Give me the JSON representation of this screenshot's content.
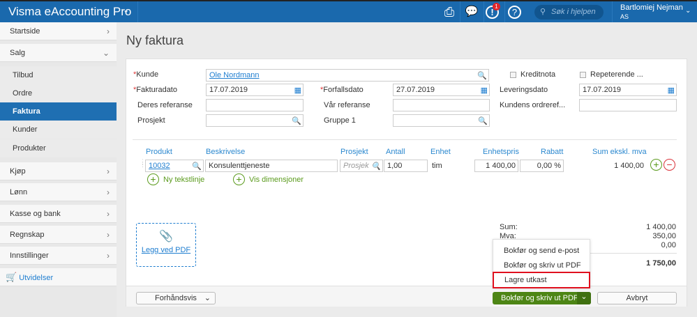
{
  "header": {
    "app_title": "Visma eAccounting Pro",
    "notification_count": "1",
    "search_placeholder": "Søk i hjelpen",
    "user_name": "Bartlomiej Nejman",
    "company": "AS"
  },
  "sidebar": {
    "items": [
      "Startside",
      "Salg",
      "Tilbud",
      "Ordre",
      "Faktura",
      "Kunder",
      "Produkter",
      "Kjøp",
      "Lønn",
      "Kasse og bank",
      "Regnskap",
      "Innstillinger",
      "Utvidelser"
    ]
  },
  "page_title": "Ny faktura",
  "form": {
    "kunde_label": "Kunde",
    "kunde_value": "Ole Nordmann",
    "kreditnota_label": "Kreditnota",
    "repeterende_label": "Repeterende ...",
    "fakturadato_label": "Fakturadato",
    "fakturadato_value": "17.07.2019",
    "forfallsdato_label": "Forfallsdato",
    "forfallsdato_value": "27.07.2019",
    "leveringsdato_label": "Leveringsdato",
    "leveringsdato_value": "17.07.2019",
    "deres_ref_label": "Deres referanse",
    "var_ref_label": "Vår referanse",
    "kundens_ordreref_label": "Kundens ordreref...",
    "prosjekt_label": "Prosjekt",
    "gruppe_label": "Gruppe 1"
  },
  "lines": {
    "columns": [
      "Produkt",
      "Beskrivelse",
      "Prosjekt",
      "Antall",
      "Enhet",
      "Enhetspris",
      "Rabatt",
      "Sum ekskl. mva"
    ],
    "row": {
      "produkt": "10032",
      "beskrivelse": "Konsulenttjeneste",
      "prosjekt_placeholder": "Prosjek",
      "antall": "1,00",
      "enhet": "tim",
      "enhetspris": "1 400,00",
      "rabatt": "0,00 %",
      "sum": "1 400,00"
    },
    "add_text_line": "Ny tekstlinje",
    "show_dimensions": "Vis dimensjoner"
  },
  "attach_pdf": "Legg ved PDF",
  "totals": {
    "sum_label": "Sum:",
    "sum": "1 400,00",
    "mva_label": "Mva:",
    "mva": "350,00",
    "rounding": "0,00",
    "total": "1 750,00"
  },
  "dropdown": {
    "items": [
      "Bokfør og send e-post",
      "Bokfør og skriv ut PDF",
      "Lagre utkast"
    ],
    "highlight_color": "#e0101e"
  },
  "footer": {
    "preview": "Forhåndsvis",
    "primary": "Bokfør og skriv ut PDF",
    "cancel": "Avbryt"
  }
}
